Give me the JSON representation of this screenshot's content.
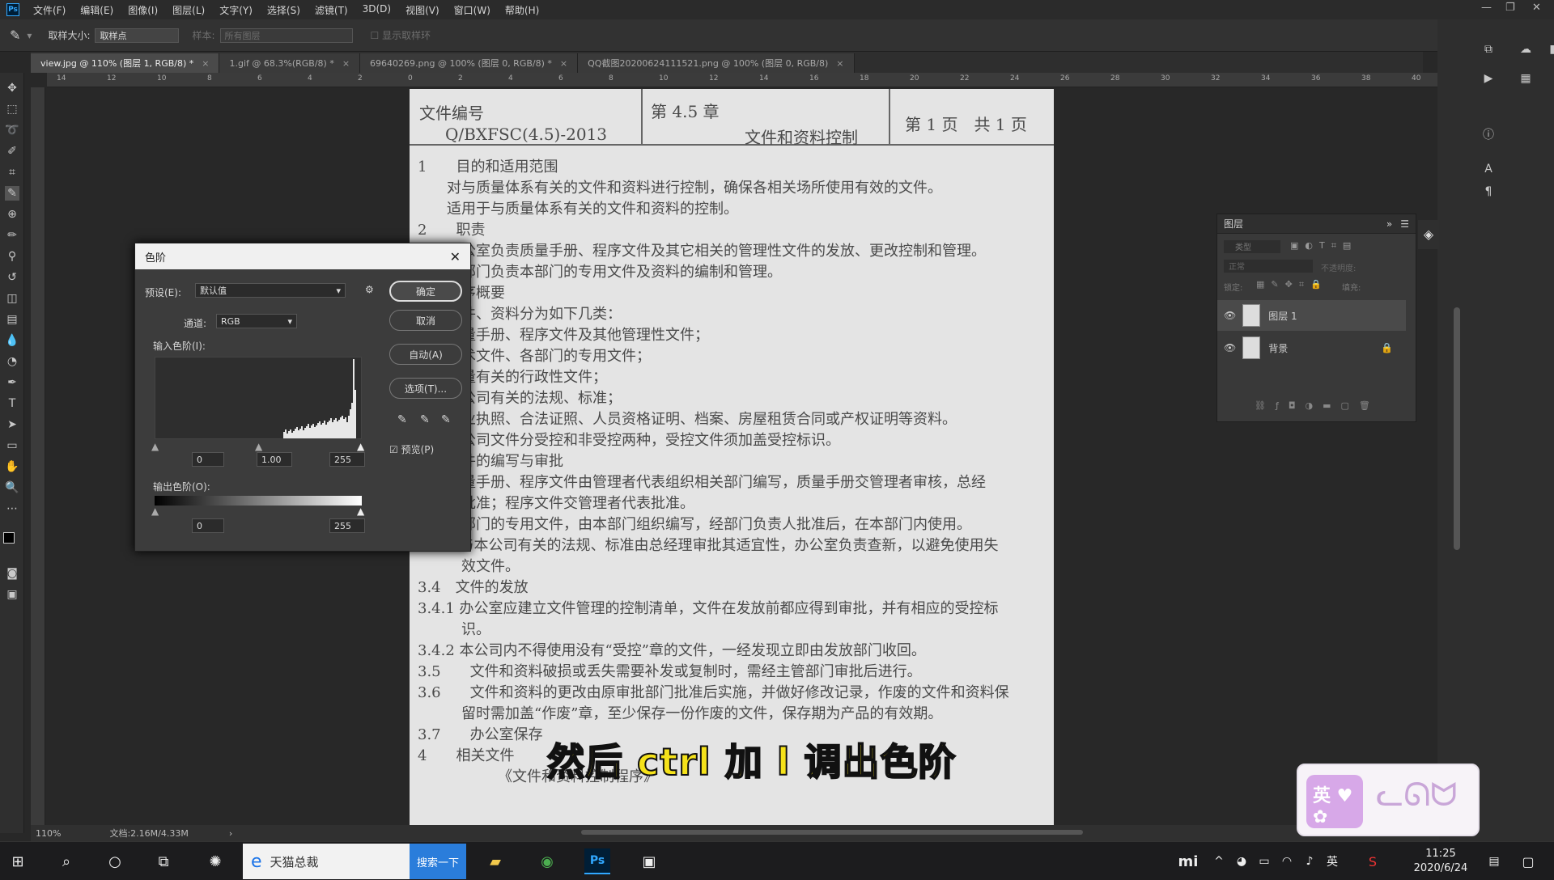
{
  "menu": [
    "文件(F)",
    "编辑(E)",
    "图像(I)",
    "图层(L)",
    "文字(Y)",
    "选择(S)",
    "滤镜(T)",
    "3D(D)",
    "视图(V)",
    "窗口(W)",
    "帮助(H)"
  ],
  "app_logo": "Ps",
  "options": {
    "sample_size_label": "取样大小:",
    "sample_size_value": "取样点",
    "sample_label": "样本:",
    "sample_value": "所有图层",
    "show_ring": "显示取样环"
  },
  "tabs": [
    {
      "label": "view.jpg @ 110% (图层 1, RGB/8) *",
      "active": true
    },
    {
      "label": "1.gif @ 68.3%(RGB/8) *",
      "active": false
    },
    {
      "label": "69640269.png @ 100% (图层 0, RGB/8) *",
      "active": false
    },
    {
      "label": "QQ截图20200624111521.png @ 100% (图层 0, RGB/8)",
      "active": false
    }
  ],
  "ruler_h": [
    "14",
    "12",
    "10",
    "8",
    "6",
    "4",
    "2",
    "0",
    "2",
    "4",
    "6",
    "8",
    "10",
    "12",
    "14",
    "16",
    "18",
    "20",
    "22",
    "24",
    "26",
    "28",
    "30",
    "32",
    "34",
    "36",
    "38",
    "40"
  ],
  "document": {
    "doc_no_label": "文件编号",
    "doc_no": "Q/BXFSC(4.5)-2013",
    "chapter": "第 4.5 章",
    "chapter_title": "文件和资料控制",
    "page": "第 1 页　共 1 页",
    "lines": [
      "1　　目的和适用范围",
      "　　对与质量体系有关的文件和资料进行控制，确保各相关场所使用有效的文件。",
      "　　适用于与质量体系有关的文件和资料的控制。",
      "2　　职责",
      "　　办公室负责质量手册、程序文件及其它相关的管理性文件的发放、更改控制和管理。",
      "　　各部门负责本部门的专用文件及资料的编制和管理。",
      "　　程序概要",
      "　　文件、资料分为如下几类：",
      "　　质量手册、程序文件及其他管理性文件；",
      "　　技术文件、各部门的专用文件；",
      "　　质量有关的行政性文件；",
      "　　本公司有关的法规、标准；",
      "　　营业执照、合法证照、人员资格证明、档案、房屋租赁合同或产权证明等资料。",
      "　　本公司文件分受控和非受控两种，受控文件须加盖受控标识。",
      "　　文件的编写与审批",
      "　　质量手册、程序文件由管理者代表组织相关部门编写，质量手册交管理者审核，总经",
      "　　理批准；程序文件交管理者代表批准。",
      "　　各部门的专用文件，由本部门组织编写，经部门负责人批准后，在本部门内使用。",
      "3.3.3 与本公司有关的法规、标准由总经理审批其适宜性，办公室负责查新，以避免使用失",
      "　　　效文件。",
      "3.4　文件的发放",
      "3.4.1 办公室应建立文件管理的控制清单，文件在发放前都应得到审批，并有相应的受控标",
      "　　　识。",
      "3.4.2 本公司内不得使用没有“受控”章的文件，一经发现立即由发放部门收回。",
      "3.5　　文件和资料破损或丢失需要补发或复制时，需经主管部门审批后进行。",
      "3.6　　文件和资料的更改由原审批部门批准后实施，并做好修改记录，作废的文件和资料保",
      "　　　留时需加盖“作废”章，至少保存一份作废的文件，保存期为产品的有效期。",
      "3.7　　办公室保存",
      "4　　相关文件",
      "　　　　　　《文件和资料控制程序》"
    ]
  },
  "subtitle": "然后 ctrl 加 l 调出色阶",
  "levels_dialog": {
    "title": "色阶",
    "preset_label": "预设(E):",
    "preset_value": "默认值",
    "channel_label": "通道:",
    "channel_value": "RGB",
    "input_label": "输入色阶(I):",
    "input_black": "0",
    "input_gamma": "1.00",
    "input_white": "255",
    "output_label": "输出色阶(O):",
    "output_black": "0",
    "output_white": "255",
    "ok": "确定",
    "cancel": "取消",
    "auto": "自动(A)",
    "options": "选项(T)...",
    "preview": "预览(P)",
    "preview_checked": true
  },
  "layers_panel": {
    "title": "图层",
    "filter_label": "类型",
    "blend_mode": "正常",
    "opacity": "不透明度:",
    "lock": "锁定:",
    "fill": "填充:",
    "layers": [
      {
        "name": "图层 1",
        "selected": true,
        "locked": false
      },
      {
        "name": "背景",
        "selected": false,
        "locked": true
      }
    ]
  },
  "status": {
    "zoom": "110%",
    "doc_size": "文档:2.16M/4.33M"
  },
  "taskbar": {
    "search_text": "天猫总裁",
    "search_btn": "搜索一下",
    "time": "11:25",
    "date": "2020/6/24",
    "ime": "英"
  },
  "sticker_text": "英"
}
